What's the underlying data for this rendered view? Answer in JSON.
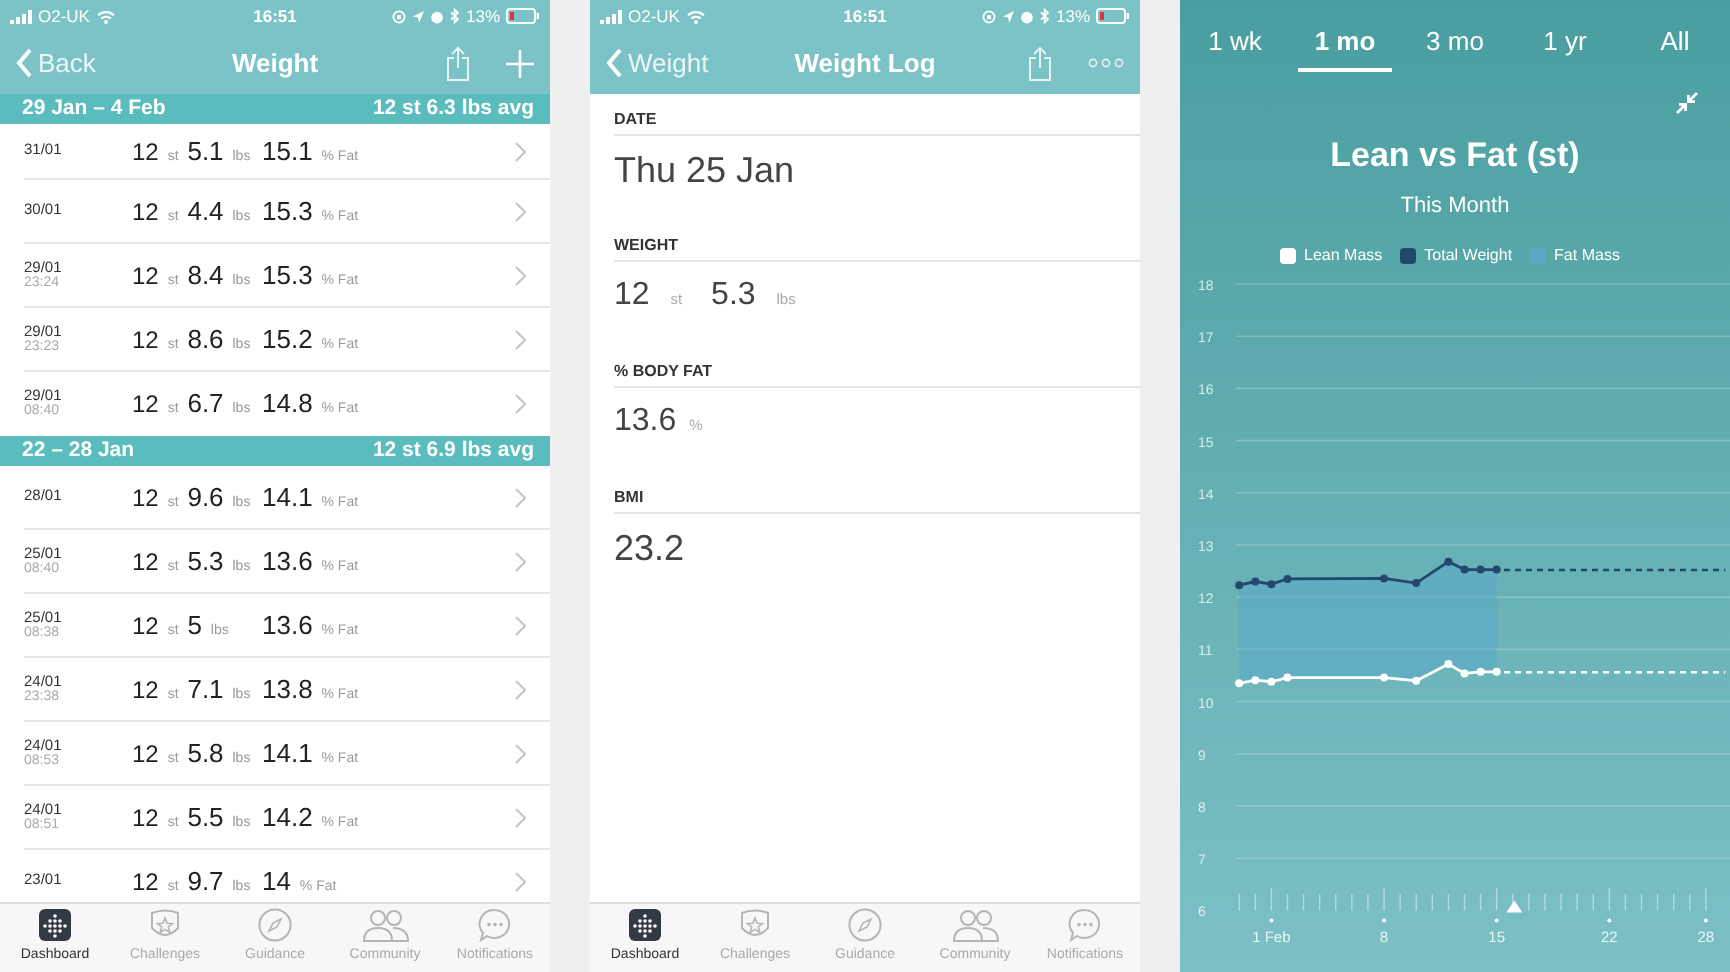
{
  "weight_list_screen": {
    "status_bar": {
      "carrier": "O2-UK",
      "time": "16:51",
      "battery": "13%"
    },
    "nav": {
      "back": "Back",
      "title": "Weight"
    },
    "sections": [
      {
        "title": "29 Jan – 4 Feb",
        "average": "12 st 6.3 lbs avg",
        "entries": [
          {
            "date": "31/01",
            "stone": "12",
            "stone_unit": "st",
            "pounds": "5.1",
            "pounds_unit": "lbs",
            "fat": "15.1",
            "fat_unit": "% Fat"
          },
          {
            "date": "30/01",
            "stone": "12",
            "stone_unit": "st",
            "pounds": "4.4",
            "pounds_unit": "lbs",
            "fat": "15.3",
            "fat_unit": "% Fat"
          },
          {
            "date": "29/01",
            "time": "23:24",
            "stone": "12",
            "stone_unit": "st",
            "pounds": "8.4",
            "pounds_unit": "lbs",
            "fat": "15.3",
            "fat_unit": "% Fat"
          },
          {
            "date": "29/01",
            "time": "23:23",
            "stone": "12",
            "stone_unit": "st",
            "pounds": "8.6",
            "pounds_unit": "lbs",
            "fat": "15.2",
            "fat_unit": "% Fat"
          },
          {
            "date": "29/01",
            "time": "08:40",
            "stone": "12",
            "stone_unit": "st",
            "pounds": "6.7",
            "pounds_unit": "lbs",
            "fat": "14.8",
            "fat_unit": "% Fat"
          }
        ]
      },
      {
        "title": "22 – 28 Jan",
        "average": "12 st 6.9 lbs avg",
        "entries": [
          {
            "date": "28/01",
            "stone": "12",
            "stone_unit": "st",
            "pounds": "9.6",
            "pounds_unit": "lbs",
            "fat": "14.1",
            "fat_unit": "% Fat"
          },
          {
            "date": "25/01",
            "time": "08:40",
            "stone": "12",
            "stone_unit": "st",
            "pounds": "5.3",
            "pounds_unit": "lbs",
            "fat": "13.6",
            "fat_unit": "% Fat"
          },
          {
            "date": "25/01",
            "time": "08:38",
            "stone": "12",
            "stone_unit": "st",
            "pounds": "5",
            "pounds_unit": "lbs",
            "fat": "13.6",
            "fat_unit": "% Fat"
          },
          {
            "date": "24/01",
            "time": "23:38",
            "stone": "12",
            "stone_unit": "st",
            "pounds": "7.1",
            "pounds_unit": "lbs",
            "fat": "13.8",
            "fat_unit": "% Fat"
          },
          {
            "date": "24/01",
            "time": "08:53",
            "stone": "12",
            "stone_unit": "st",
            "pounds": "5.8",
            "pounds_unit": "lbs",
            "fat": "14.1",
            "fat_unit": "% Fat"
          },
          {
            "date": "24/01",
            "time": "08:51",
            "stone": "12",
            "stone_unit": "st",
            "pounds": "5.5",
            "pounds_unit": "lbs",
            "fat": "14.2",
            "fat_unit": "% Fat"
          },
          {
            "date": "23/01",
            "stone": "12",
            "stone_unit": "st",
            "pounds": "9.7",
            "pounds_unit": "lbs",
            "fat": "14",
            "fat_unit": "% Fat"
          }
        ]
      }
    ],
    "tab_bar": [
      {
        "label": "Dashboard",
        "selected": true
      },
      {
        "label": "Challenges",
        "selected": false
      },
      {
        "label": "Guidance",
        "selected": false
      },
      {
        "label": "Community",
        "selected": false
      },
      {
        "label": "Notifications",
        "selected": false
      }
    ]
  },
  "weight_log_screen": {
    "status_bar": {
      "carrier": "O2-UK",
      "time": "16:51",
      "battery": "13%"
    },
    "nav": {
      "back": "Weight",
      "title": "Weight Log"
    },
    "fields": [
      {
        "label": "DATE",
        "parts": [
          {
            "value": "Thu 25 Jan"
          }
        ]
      },
      {
        "label": "WEIGHT",
        "parts": [
          {
            "value": "12",
            "unit": "st"
          },
          {
            "value": "5.3",
            "unit": "lbs"
          }
        ]
      },
      {
        "label": "% BODY FAT",
        "parts": [
          {
            "value": "13.6",
            "unit": "%"
          }
        ]
      },
      {
        "label": "BMI",
        "parts": [
          {
            "value": "23.2"
          }
        ]
      }
    ],
    "tab_bar": [
      {
        "label": "Dashboard",
        "selected": true
      },
      {
        "label": "Challenges",
        "selected": false
      },
      {
        "label": "Guidance",
        "selected": false
      },
      {
        "label": "Community",
        "selected": false
      },
      {
        "label": "Notifications",
        "selected": false
      }
    ]
  },
  "chart_screen": {
    "periods": [
      {
        "label": "1 wk",
        "selected": false
      },
      {
        "label": "1 mo",
        "selected": true
      },
      {
        "label": "3 mo",
        "selected": false
      },
      {
        "label": "1 yr",
        "selected": false
      },
      {
        "label": "All",
        "selected": false
      }
    ],
    "title": "Lean vs Fat (st)",
    "subtitle": "This Month",
    "area_legend": {
      "name": "Fat Mass",
      "color": "#5aa8c8"
    },
    "chart_data": {
      "type": "line",
      "x": [
        -1,
        0,
        1,
        2,
        8,
        10,
        12,
        13,
        14,
        15
      ],
      "series": [
        {
          "name": "Lean Mass",
          "color": "#ffffff",
          "marker": "o",
          "values": [
            10.35,
            10.41,
            10.38,
            10.46,
            10.46,
            10.4,
            10.72,
            10.54,
            10.57,
            10.57
          ]
        },
        {
          "name": "Total Weight",
          "color": "#24476c",
          "marker": "o",
          "values": [
            12.23,
            12.3,
            12.25,
            12.35,
            12.36,
            12.27,
            12.68,
            12.53,
            12.53,
            12.53
          ]
        }
      ],
      "grid": true,
      "xlim": [
        -1.2,
        29.5
      ],
      "ylim": [
        6,
        18
      ],
      "yticks": [
        6,
        7,
        8,
        9,
        10,
        11,
        12,
        13,
        14,
        15,
        16,
        17,
        18
      ],
      "xticks": [
        {
          "value": 1,
          "label": "1 Feb"
        },
        8,
        15,
        22,
        28
      ]
    }
  }
}
